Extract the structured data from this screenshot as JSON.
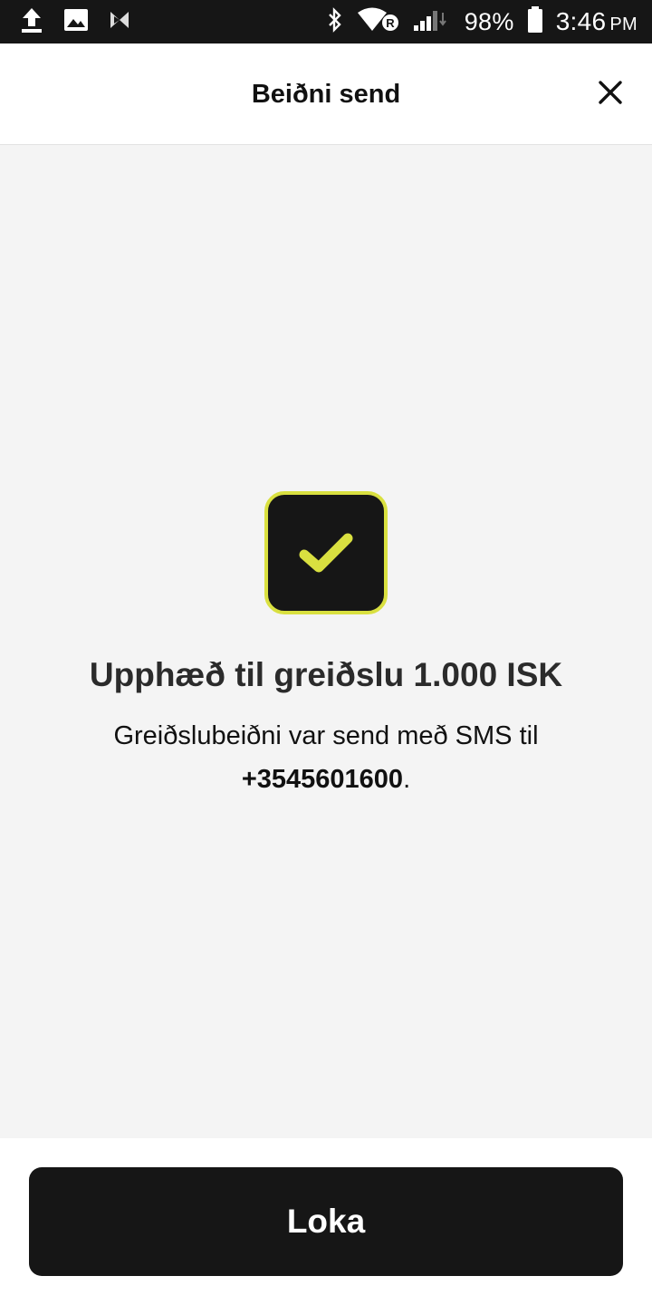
{
  "status_bar": {
    "battery": "98%",
    "time": "3:46",
    "ampm": "PM",
    "icons": [
      "upload-icon",
      "image-icon",
      "app-icon",
      "bluetooth-icon",
      "wifi-icon",
      "signal-icon",
      "battery-icon"
    ]
  },
  "header": {
    "title": "Beiðni send",
    "close_icon": "close-icon"
  },
  "result": {
    "icon": "checkmark-icon",
    "title": "Upphæð til greiðslu 1.000 ISK",
    "message_prefix": "Greiðslubeiðni var send með SMS til",
    "phone": "+3545601600",
    "message_suffix": "."
  },
  "footer": {
    "button_label": "Loka"
  },
  "colors": {
    "accent": "#d9e040",
    "dark": "#161616",
    "background": "#f4f4f4"
  }
}
